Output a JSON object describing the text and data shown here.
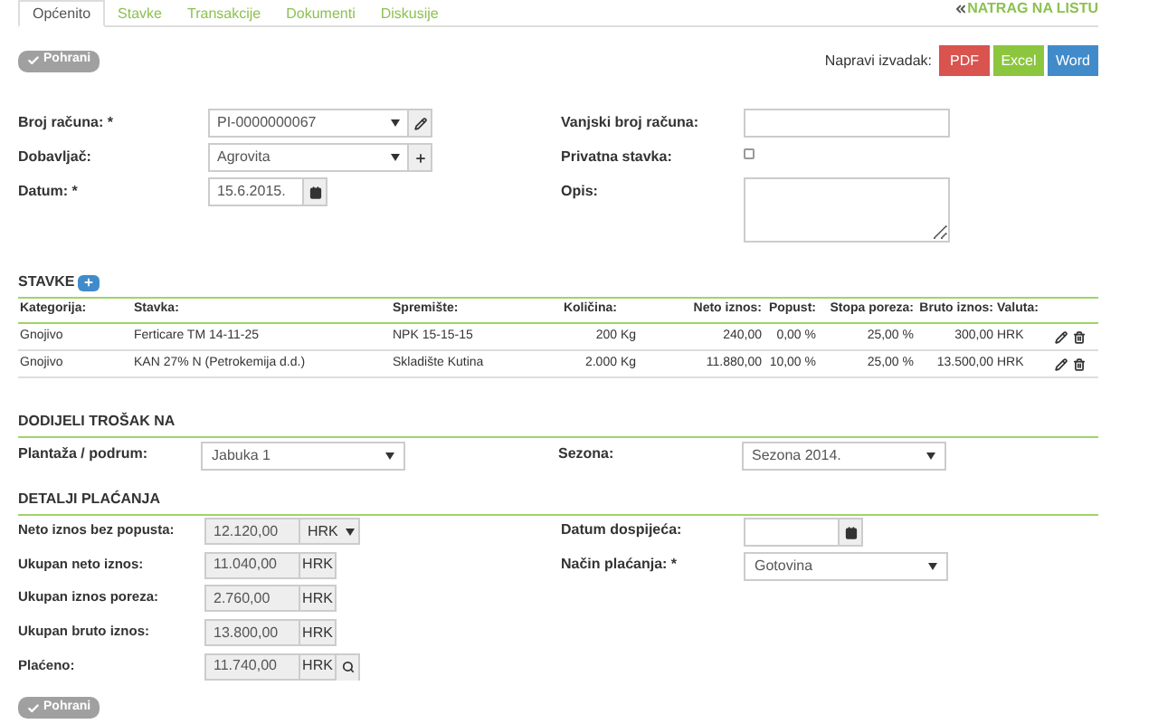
{
  "tabs": [
    {
      "label": "Općenito",
      "selected": true
    },
    {
      "label": "Stavke",
      "selected": false
    },
    {
      "label": "Transakcije",
      "selected": false
    },
    {
      "label": "Dokumenti",
      "selected": false
    },
    {
      "label": "Diskusije",
      "selected": false
    }
  ],
  "back_link": "NATRAG NA LISTU",
  "save_button": "Pohrani",
  "export": {
    "label": "Napravi izvadak:",
    "buttons": [
      {
        "label": "PDF",
        "color": "#d9534f"
      },
      {
        "label": "Excel",
        "color": "#8cc63f"
      },
      {
        "label": "Word",
        "color": "#428bca"
      }
    ]
  },
  "form_left": [
    {
      "label": "Broj računa: *",
      "kind": "edit",
      "value": "PI-0000000067"
    },
    {
      "label": "Dobavljač:",
      "kind": "add",
      "value": "Agrovita"
    },
    {
      "label": "Datum: *",
      "kind": "date",
      "value": "15.6.2015."
    }
  ],
  "form_right": [
    {
      "label": "Vanjski broj računa:",
      "kind": "text"
    },
    {
      "label": "Privatna stavka:",
      "kind": "checkbox",
      "checked": false
    },
    {
      "label": "Opis:",
      "kind": "textarea"
    }
  ],
  "items": {
    "title": "STAVKE",
    "columns": [
      "Kategorija:",
      "Stavka:",
      "Spremište:",
      "Količina:",
      "",
      "Neto iznos:",
      "Popust:",
      "Stopa poreza:",
      "Bruto iznos:",
      "Valuta:"
    ],
    "rows": [
      [
        "Gnojivo",
        "Ferticare TM 14-11-25",
        "NPK 15-15-15",
        "200",
        "Kg",
        "240,00",
        "0,00 %",
        "25,00 %",
        "300,00",
        "HRK"
      ],
      [
        "Gnojivo",
        "KAN 27% N (Petrokemija d.d.)",
        "Skladište Kutina",
        "2.000",
        "Kg",
        "11.880,00",
        "10,00 %",
        "25,00 %",
        "13.500,00",
        "HRK"
      ]
    ]
  },
  "allocation": {
    "title": "DODIJELI TROŠAK NA",
    "fields": [
      {
        "label": "Plantaža / podrum:",
        "value": "Jabuka 1"
      },
      {
        "label": "Sezona:",
        "value": "Sezona 2014."
      }
    ]
  },
  "payment": {
    "title": "DETALJI PLAĆANJA",
    "left": [
      {
        "label": "Neto iznos bez popusta:",
        "value": "12.120,00",
        "currency": "HRK",
        "kind": "dropdown"
      },
      {
        "label": "Ukupan neto iznos:",
        "value": "11.040,00",
        "currency": "HRK",
        "kind": "plain"
      },
      {
        "label": "Ukupan iznos poreza:",
        "value": "2.760,00",
        "currency": "HRK",
        "kind": "plain"
      },
      {
        "label": "Ukupan bruto iznos:",
        "value": "13.800,00",
        "currency": "HRK",
        "kind": "plain"
      },
      {
        "label": "Plaćeno:",
        "value": "11.740,00",
        "currency": "HRK",
        "kind": "lookup"
      }
    ],
    "right": [
      {
        "label": "Datum dospijeća:",
        "kind": "date"
      },
      {
        "label": "Način plaćanja: *",
        "kind": "select",
        "value": "Gotovina"
      }
    ]
  },
  "bottom_save_button": "Pohrani"
}
